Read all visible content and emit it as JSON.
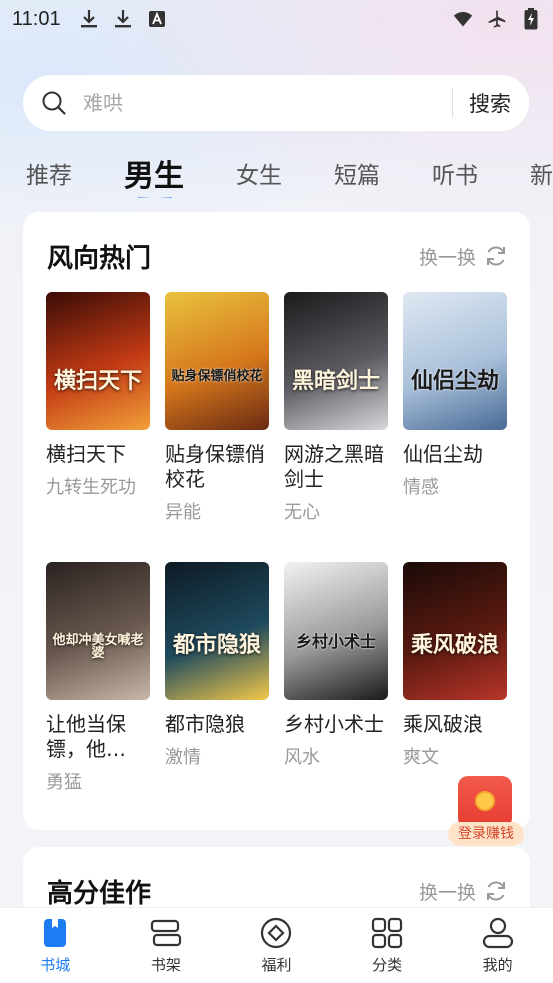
{
  "status_bar": {
    "time": "11:01",
    "left_icons": [
      "download-icon",
      "download-icon",
      "text-a-icon"
    ],
    "right_icons": [
      "wifi-icon",
      "airplane-icon",
      "battery-charging-icon"
    ]
  },
  "search": {
    "placeholder": "难哄",
    "button_label": "搜索"
  },
  "tabs": [
    {
      "label": "推荐",
      "active": false
    },
    {
      "label": "男生",
      "active": true
    },
    {
      "label": "女生",
      "active": false
    },
    {
      "label": "短篇",
      "active": false
    },
    {
      "label": "听书",
      "active": false
    },
    {
      "label": "新",
      "active": false
    }
  ],
  "section1": {
    "title": "风向热门",
    "refresh_label": "换一换",
    "books": [
      {
        "name": "横扫天下",
        "tag": "九转生死功",
        "cover_text": "横扫天下",
        "cover_colors": [
          "#3a0c07",
          "#c23a14",
          "#f2a03a"
        ]
      },
      {
        "name": "贴身保镖俏校花",
        "tag": "异能",
        "cover_text": "贴身保镖俏校花",
        "cover_colors": [
          "#e9c23e",
          "#d6781c",
          "#6a2a12"
        ]
      },
      {
        "name": "网游之黑暗剑士",
        "tag": "无心",
        "cover_text": "黑暗剑士",
        "cover_colors": [
          "#1b1b1d",
          "#5a5a60",
          "#d8d8dc"
        ]
      },
      {
        "name": "仙侣尘劫",
        "tag": "情感",
        "cover_text": "仙侣尘劫",
        "cover_colors": [
          "#dfe8f2",
          "#aac1da",
          "#4a6a96"
        ]
      },
      {
        "name": "让他当保镖，他…",
        "tag": "勇猛",
        "cover_text": "他却冲美女喊老婆",
        "cover_colors": [
          "#2a2220",
          "#6a5a50",
          "#c8b8a8"
        ]
      },
      {
        "name": "都市隐狼",
        "tag": "激情",
        "cover_text": "都市隐狼",
        "cover_colors": [
          "#0d1a24",
          "#1f4a5e",
          "#f2c84a"
        ]
      },
      {
        "name": "乡村小术士",
        "tag": "风水",
        "cover_text": "乡村小术士",
        "cover_colors": [
          "#f2f2f2",
          "#9a9a9a",
          "#1a1a1a"
        ]
      },
      {
        "name": "乘风破浪",
        "tag": "爽文",
        "cover_text": "乘风破浪",
        "cover_colors": [
          "#1a0a08",
          "#5a1a10",
          "#b8342a"
        ]
      }
    ]
  },
  "float_promo": {
    "label": "登录赚钱"
  },
  "section2": {
    "title": "高分佳作",
    "refresh_label": "换一换"
  },
  "bottom_nav": [
    {
      "label": "书城",
      "icon": "bookstore-icon",
      "active": true
    },
    {
      "label": "书架",
      "icon": "bookshelf-icon",
      "active": false
    },
    {
      "label": "福利",
      "icon": "welfare-icon",
      "active": false
    },
    {
      "label": "分类",
      "icon": "category-icon",
      "active": false
    },
    {
      "label": "我的",
      "icon": "profile-icon",
      "active": false
    }
  ],
  "colors": {
    "accent": "#1e7cf2",
    "tab_underline": "#4a8ff0"
  }
}
